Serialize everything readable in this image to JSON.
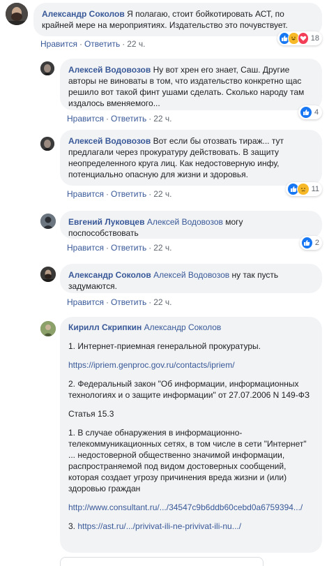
{
  "comments": [
    {
      "author": "Александр Соколов",
      "mention": "",
      "text": "Я полагаю, стоит бойкотировать АСТ, по крайней мере на мероприятиях. Издательство это почувствует.",
      "like": "Нравится",
      "reply": "Ответить",
      "time": "22 ч.",
      "reactions": [
        "like",
        "haha",
        "love"
      ],
      "reaction_count": "18"
    },
    {
      "author": "Алексей Водовозов",
      "mention": "",
      "text": "Ну вот хрен его знает, Саш. Другие авторы не виноваты в том, что издательство конкретно щас решило вот такой финт ушами сделать. Сколько народу там издалось вменяемого...",
      "like": "Нравится",
      "reply": "Ответить",
      "time": "22 ч.",
      "reactions": [
        "like"
      ],
      "reaction_count": "4"
    },
    {
      "author": "Алексей Водовозов",
      "mention": "",
      "text": "Вот если бы отозвать тираж... тут предлагали через прокуратуру действовать. В защиту неопределенного круга лиц. Как недостоверную инфу, потенциально опасную для жизни и здоровья.",
      "like": "Нравится",
      "reply": "Ответить",
      "time": "22 ч.",
      "reactions": [
        "like",
        "sad"
      ],
      "reaction_count": "11"
    },
    {
      "author": "Евгений Луковцев",
      "mention": "Алексей Водовозов",
      "text": "могу поспособствовать",
      "like": "Нравится",
      "reply": "Ответить",
      "time": "22 ч.",
      "reactions": [
        "like"
      ],
      "reaction_count": "2"
    },
    {
      "author": "Александр Соколов",
      "mention": "Алексей Водовозов",
      "text": "ну так пусть задумаются.",
      "like": "Нравится",
      "reply": "Ответить",
      "time": "22 ч."
    },
    {
      "author": "Кирилл Скрипкин",
      "mention": "Александр Соколов",
      "paragraphs": [
        "1. Интернет-приемная генеральной прокуратуры.",
        "https://ipriem.genproc.gov.ru/contacts/ipriem/",
        "2. Федеральный закон \"Об информации, информационных технологиях и о защите информации\" от 27.07.2006 N 149-ФЗ",
        "Статья 15.3",
        "1. В случае обнаружения в информационно-телекоммуникационных сетях, в том числе в сети \"Интернет\" ... недостоверной общественно значимой информации, распространяемой под видом достоверных сообщений, которая создает угрозу причинения вреда жизни и (или) здоровью граждан",
        "http://www.consultant.ru/.../34547c9b6ddb60cebd0a6759394.../",
        "3. https://ast.ru/.../privivat-ili-ne-privivat-ili-nu.../"
      ],
      "last_prefix": "3. ",
      "last_link": "https://ast.ru/.../privivat-ili-ne-privivat-ili-nu.../"
    }
  ]
}
